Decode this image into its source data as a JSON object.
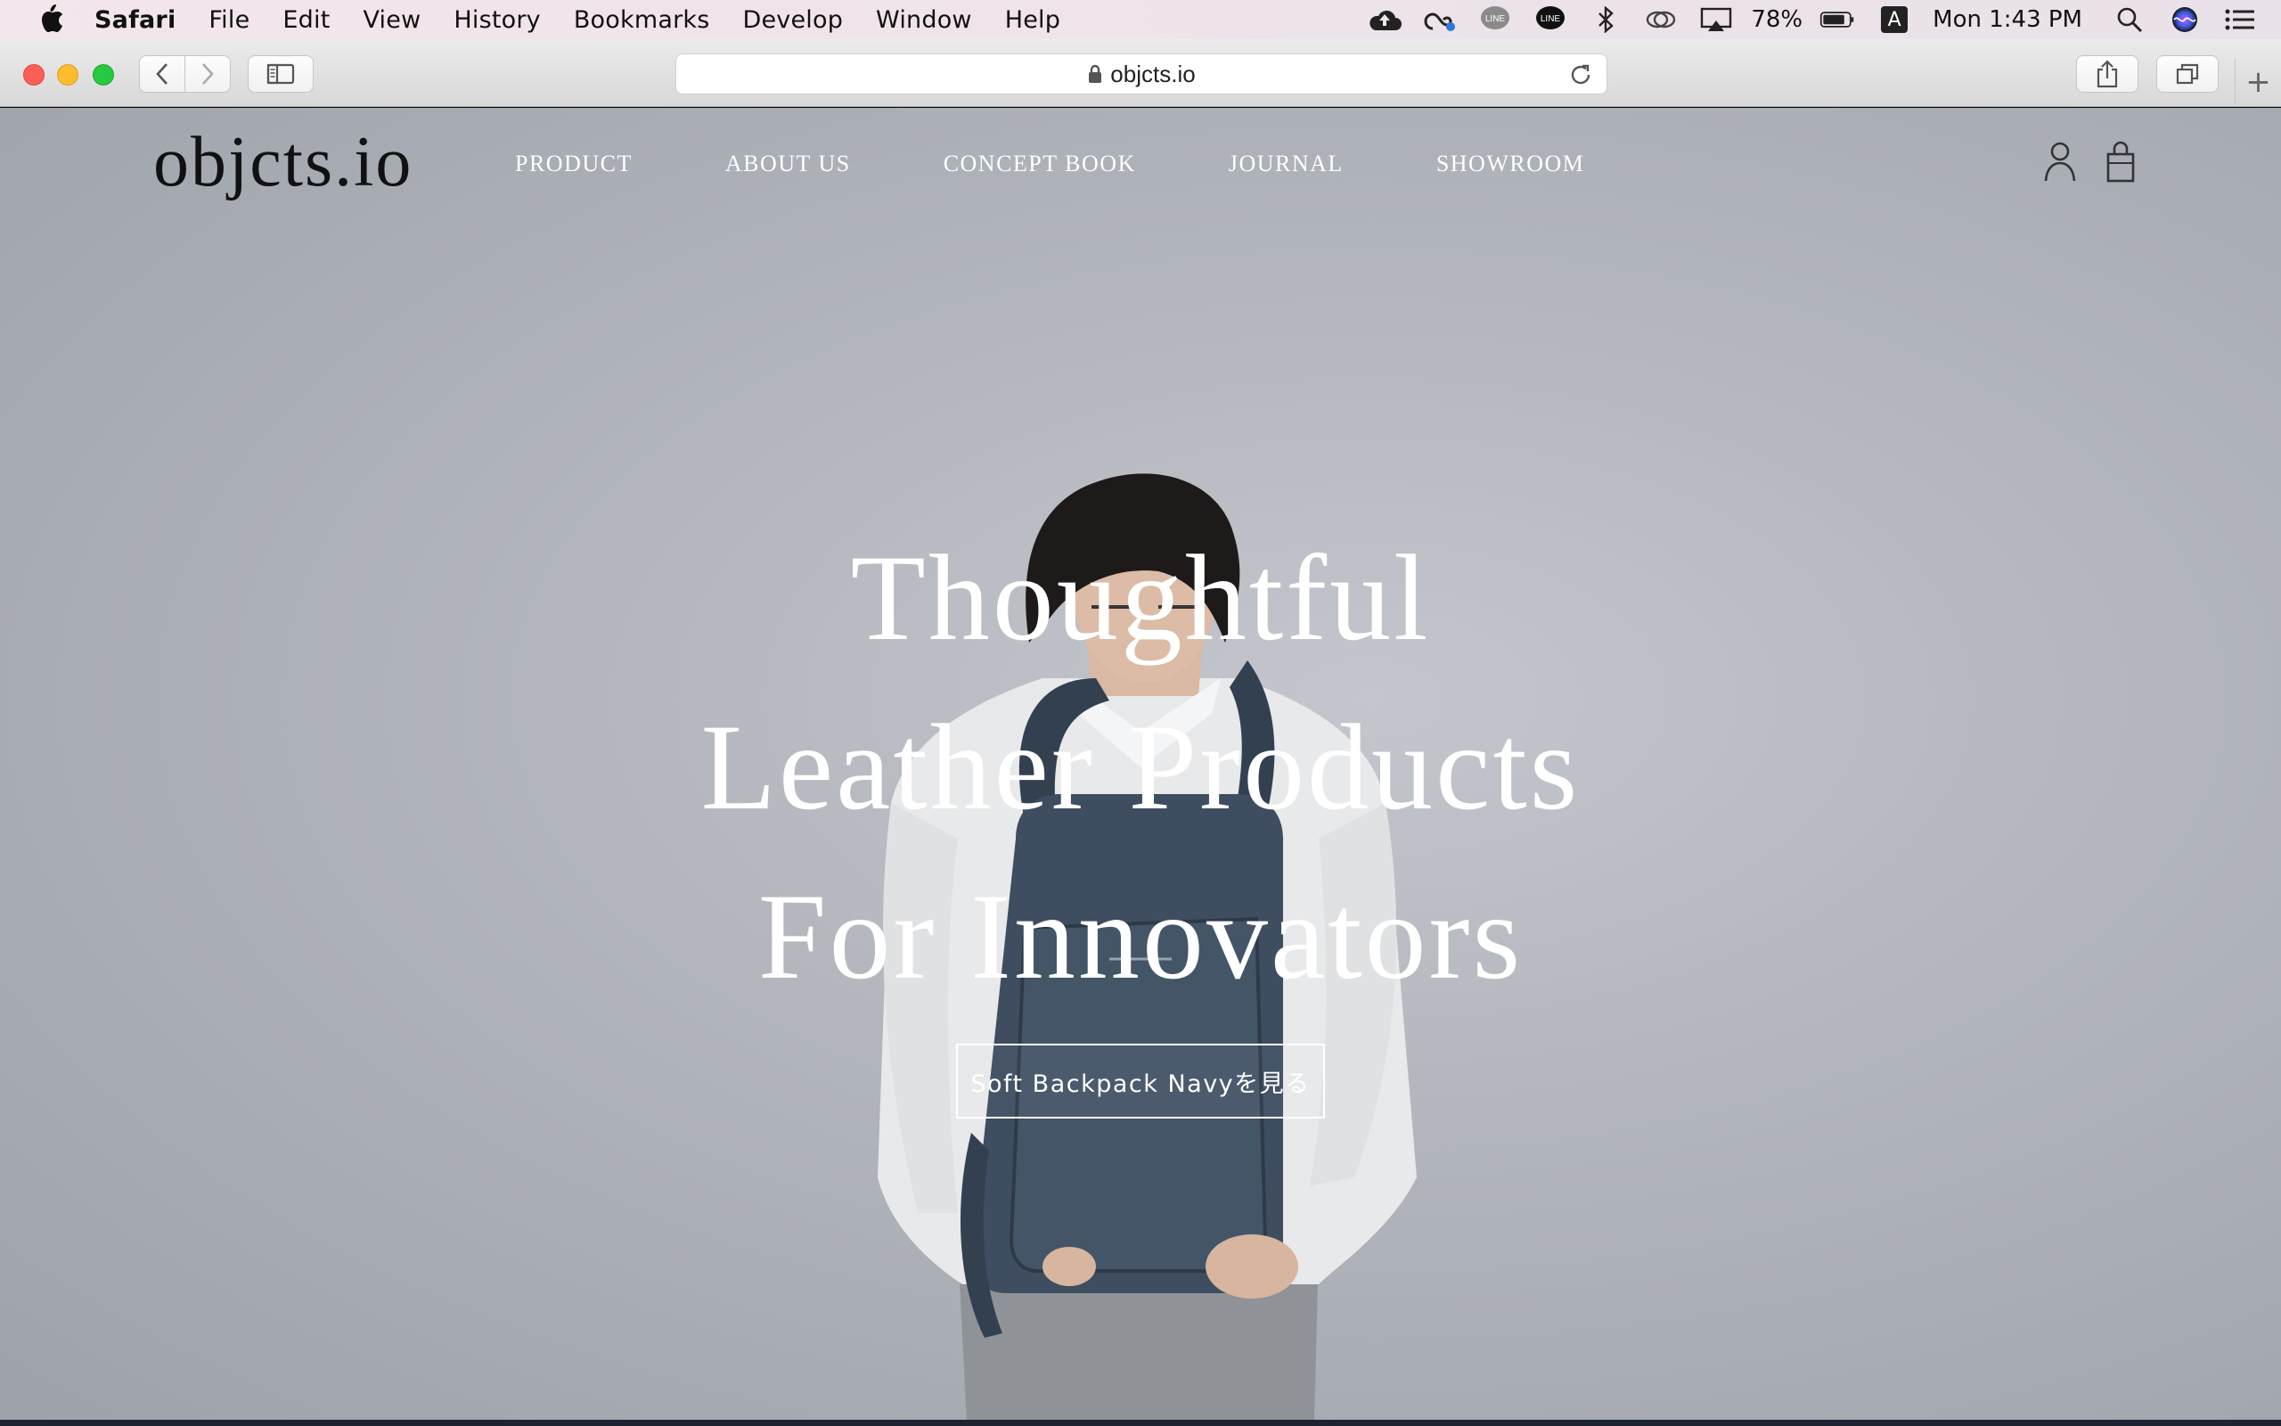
{
  "menubar": {
    "app_name": "Safari",
    "items": [
      "File",
      "Edit",
      "View",
      "History",
      "Bookmarks",
      "Develop",
      "Window",
      "Help"
    ],
    "battery": "78%",
    "clock": "Mon 1:43 PM",
    "input_source": "A"
  },
  "toolbar": {
    "url": "objcts.io"
  },
  "site": {
    "logo": "objcts.io",
    "nav": [
      "PRODUCT",
      "ABOUT US",
      "CONCEPT BOOK",
      "JOURNAL",
      "SHOWROOM"
    ],
    "hero": {
      "line1": "Thoughtful",
      "line2": "Leather Products",
      "line3": "For Innovators",
      "cta": "Soft Backpack Navyを見る"
    }
  },
  "colors": {
    "hero_background": "#b3b7bd",
    "backpack": "#3e4e60"
  }
}
